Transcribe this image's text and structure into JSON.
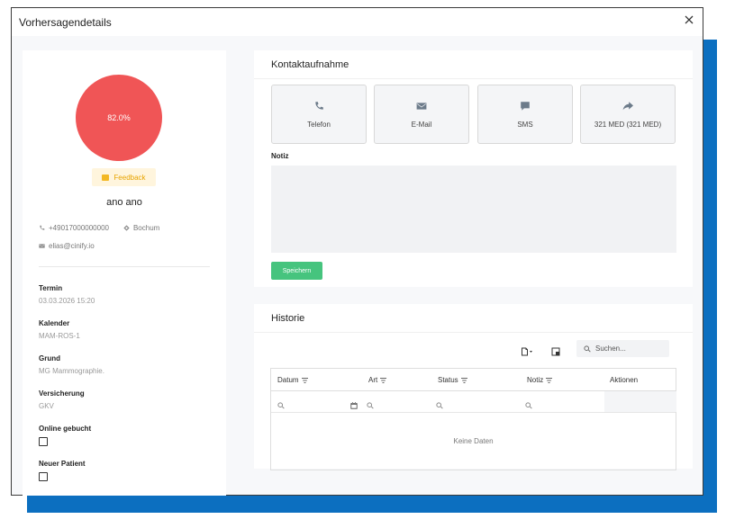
{
  "modal": {
    "title": "Vorhersagendetails"
  },
  "patient": {
    "score": "82.0%",
    "feedback_label": "Feedback",
    "name": "ano ano",
    "phone": "+49017000000000",
    "location": "Bochum",
    "email": "elias@cinify.io"
  },
  "details": {
    "termin_label": "Termin",
    "termin_value": "03.03.2026 15:20",
    "kalender_label": "Kalender",
    "kalender_value": "MAM-ROS-1",
    "grund_label": "Grund",
    "grund_value": "MG Mammographie.",
    "versicherung_label": "Versicherung",
    "versicherung_value": "GKV",
    "online_label": "Online gebucht",
    "neuer_label": "Neuer Patient"
  },
  "contact": {
    "title": "Kontaktaufnahme",
    "buttons": [
      {
        "label": "Telefon",
        "icon": "phone-icon"
      },
      {
        "label": "E-Mail",
        "icon": "mail-icon"
      },
      {
        "label": "SMS",
        "icon": "sms-icon"
      },
      {
        "label": "321 MED (321 MED)",
        "icon": "forward-icon"
      }
    ],
    "notiz_label": "Notiz",
    "save_label": "Speichern"
  },
  "history": {
    "title": "Historie",
    "search_placeholder": "Suchen...",
    "columns": [
      "Datum",
      "Art",
      "Status",
      "Notiz",
      "Aktionen"
    ],
    "empty_text": "Keine Daten"
  },
  "colors": {
    "score": "#f05556",
    "save": "#46c47e",
    "accent_blue": "#0c6fc0",
    "feedback": "#f3b824"
  }
}
